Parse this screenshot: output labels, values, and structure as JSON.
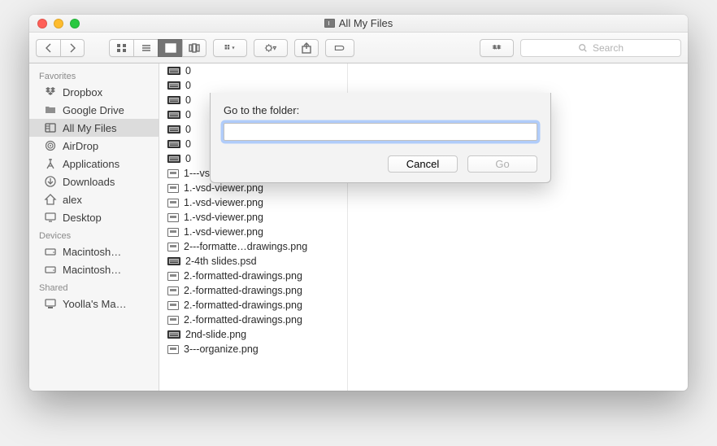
{
  "window": {
    "title": "All My Files"
  },
  "toolbar": {
    "search_placeholder": "Search"
  },
  "sidebar": {
    "sections": [
      {
        "heading": "Favorites",
        "items": [
          {
            "icon": "dropbox",
            "label": "Dropbox"
          },
          {
            "icon": "folder",
            "label": "Google Drive"
          },
          {
            "icon": "allfiles",
            "label": "All My Files",
            "selected": true
          },
          {
            "icon": "airdrop",
            "label": "AirDrop"
          },
          {
            "icon": "apps",
            "label": "Applications"
          },
          {
            "icon": "downloads",
            "label": "Downloads"
          },
          {
            "icon": "home",
            "label": "alex"
          },
          {
            "icon": "desktop",
            "label": "Desktop"
          }
        ]
      },
      {
        "heading": "Devices",
        "items": [
          {
            "icon": "disk",
            "label": "Macintosh…"
          },
          {
            "icon": "disk",
            "label": "Macintosh…"
          }
        ]
      },
      {
        "heading": "Shared",
        "items": [
          {
            "icon": "computer",
            "label": "Yoolla's Ma…"
          }
        ]
      }
    ]
  },
  "files": [
    {
      "name": "0",
      "wide": true
    },
    {
      "name": "0",
      "wide": true
    },
    {
      "name": "0",
      "wide": true
    },
    {
      "name": "0",
      "wide": true
    },
    {
      "name": "0",
      "wide": true
    },
    {
      "name": "0",
      "wide": true
    },
    {
      "name": "0",
      "wide": true
    },
    {
      "name": "1---vsd-viewer.png"
    },
    {
      "name": "1.-vsd-viewer.png"
    },
    {
      "name": "1.-vsd-viewer.png"
    },
    {
      "name": "1.-vsd-viewer.png"
    },
    {
      "name": "1.-vsd-viewer.png"
    },
    {
      "name": "2---formatte…drawings.png"
    },
    {
      "name": "2-4th slides.psd",
      "wide": true
    },
    {
      "name": "2.-formatted-drawings.png"
    },
    {
      "name": "2.-formatted-drawings.png"
    },
    {
      "name": "2.-formatted-drawings.png"
    },
    {
      "name": "2.-formatted-drawings.png"
    },
    {
      "name": "2nd-slide.png",
      "wide": true
    },
    {
      "name": "3---organize.png"
    }
  ],
  "dialog": {
    "label": "Go to the folder:",
    "value": "",
    "cancel": "Cancel",
    "go": "Go"
  }
}
